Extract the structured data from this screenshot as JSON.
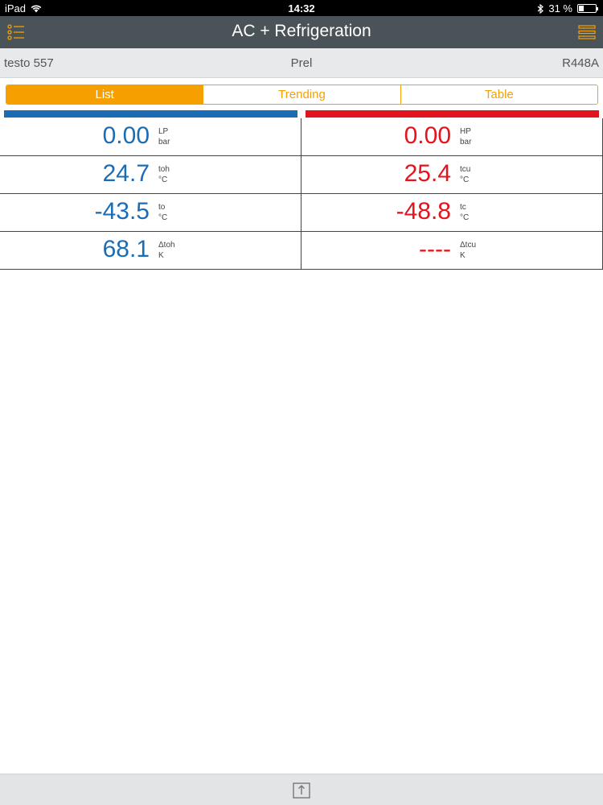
{
  "status_bar": {
    "device": "iPad",
    "time": "14:32",
    "battery": "31 %",
    "battery_level": 0.31
  },
  "nav": {
    "title": "AC + Refrigeration",
    "left_icon": "list-menu-icon",
    "right_icon": "hamburger-menu-icon"
  },
  "info": {
    "device_name": "testo 557",
    "mode": "Prel",
    "refrigerant": "R448A"
  },
  "tabs": [
    {
      "label": "List",
      "active": true
    },
    {
      "label": "Trending",
      "active": false
    },
    {
      "label": "Table",
      "active": false
    }
  ],
  "colors": {
    "low_side": "#1a6db4",
    "high_side": "#e3141d",
    "accent": "#f5a000"
  },
  "readings": [
    {
      "left": {
        "value": "0.00",
        "name": "LP",
        "unit": "bar"
      },
      "right": {
        "value": "0.00",
        "name": "HP",
        "unit": "bar"
      }
    },
    {
      "left": {
        "value": "24.7",
        "name": "toh",
        "unit": "°C"
      },
      "right": {
        "value": "25.4",
        "name": "tcu",
        "unit": "°C"
      }
    },
    {
      "left": {
        "value": "-43.5",
        "name": "to",
        "unit": "°C"
      },
      "right": {
        "value": "-48.8",
        "name": "tc",
        "unit": "°C"
      }
    },
    {
      "left": {
        "value": "68.1",
        "name": "Δtoh",
        "unit": "K"
      },
      "right": {
        "value": "----",
        "name": "Δtcu",
        "unit": "K"
      }
    }
  ],
  "bottom": {
    "share_icon": "share-upload-icon"
  }
}
